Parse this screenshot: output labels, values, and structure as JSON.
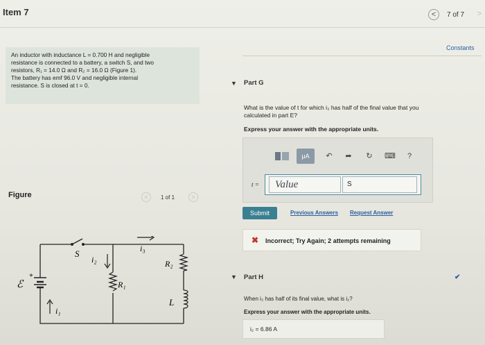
{
  "header": {
    "title": "Item 7",
    "prev": "<",
    "counter": "7 of 7",
    "next": ">"
  },
  "problem": {
    "line1": "An inductor with inductance L = 0.700  H and negligible",
    "line2": "resistance is connected to a battery, a switch S, and two",
    "line3": "resistors, R₁ = 14.0  Ω and R₂ = 16.0  Ω (Figure 1).",
    "line4": "The battery has emf 96.0 V and negligible internal",
    "line5": "resistance. S is closed at t = 0."
  },
  "figure": {
    "label": "Figure",
    "pager_prev": "<",
    "pager_text": "1 of 1",
    "pager_next": ">",
    "labels": {
      "emf": "ℰ",
      "switch": "S",
      "i1": "i₁",
      "i2": "i₂",
      "i3": "i₃",
      "r1": "R₁",
      "r2": "R₂",
      "l": "L",
      "plus": "+"
    }
  },
  "constants_link": "Constants",
  "part_g": {
    "title": "Part G",
    "question_line1": "What is the value of t for which i₃ has half of the final value that you",
    "question_line2": "calculated in part E?",
    "instruction": "Express your answer with the appropriate units.",
    "toolbar": {
      "units_label": "μA",
      "undo": "↶",
      "redo": "➦",
      "reset": "↻",
      "keyboard": "⌨",
      "help": "?"
    },
    "variable_label": "t =",
    "value_placeholder": "Value",
    "units_value": "S",
    "submit_label": "Submit",
    "previous_answers": "Previous Answers",
    "request_answer": "Request Answer",
    "feedback_icon": "✖",
    "feedback_text": "Incorrect; Try Again; 2 attempts remaining"
  },
  "part_h": {
    "title": "Part H",
    "question": "When i₃ has half of its final value, what is i₂?",
    "instruction": "Express your answer with the appropriate units.",
    "answer_label": "i₂ =",
    "answer_value": "6.86 A",
    "status_icon": "✔"
  },
  "colors": {
    "link": "#2a5fa0",
    "submit": "#3b7f93",
    "error": "#c0392b",
    "problem_bg": "#dde4dc"
  }
}
